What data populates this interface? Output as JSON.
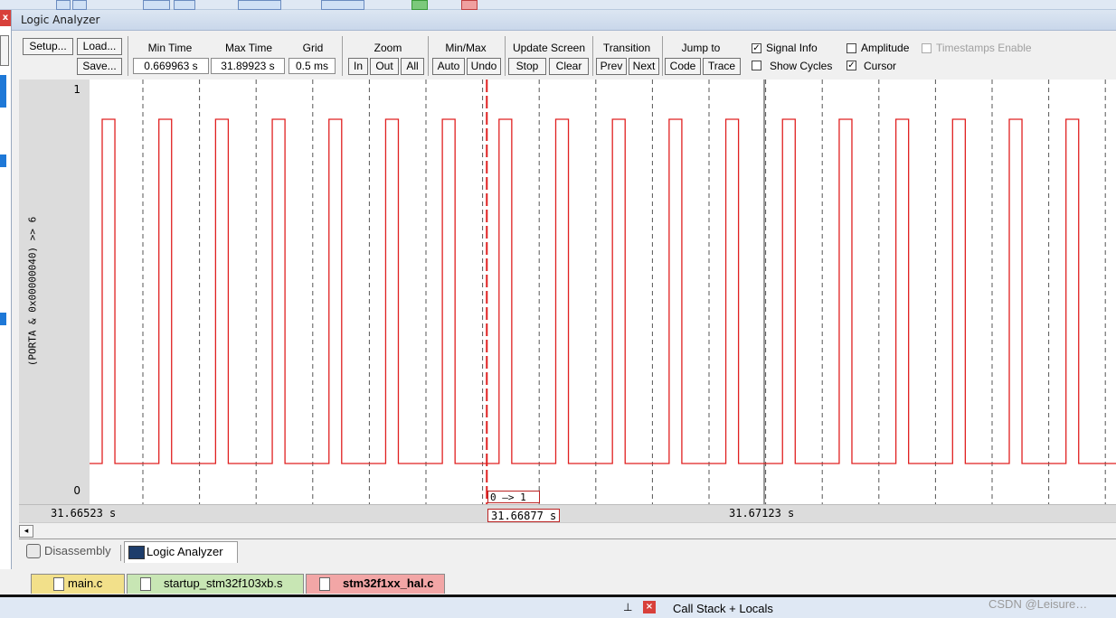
{
  "panel": {
    "title": "Logic Analyzer",
    "close_glyph": "x"
  },
  "controls": {
    "setup_label": "Setup...",
    "load_label": "Load...",
    "save_label": "Save...",
    "min_time_label": "Min Time",
    "min_time_value": "0.669963 s",
    "max_time_label": "Max Time",
    "max_time_value": "31.89923 s",
    "grid_label": "Grid",
    "grid_value": "0.5 ms",
    "zoom_label": "Zoom",
    "zoom_in": "In",
    "zoom_out": "Out",
    "zoom_all": "All",
    "minmax_label": "Min/Max",
    "minmax_auto": "Auto",
    "minmax_undo": "Undo",
    "update_label": "Update Screen",
    "update_stop": "Stop",
    "update_clear": "Clear",
    "transition_label": "Transition",
    "transition_prev": "Prev",
    "transition_next": "Next",
    "jump_label": "Jump to",
    "jump_code": "Code",
    "jump_trace": "Trace",
    "signal_info": {
      "label": "Signal Info",
      "checked": true
    },
    "amplitude": {
      "label": "Amplitude",
      "checked": false
    },
    "timestamps": {
      "label": "Timestamps Enable",
      "checked": false,
      "disabled": true
    },
    "show_cycles": {
      "label": "Show Cycles",
      "checked": false
    },
    "cursor": {
      "label": "Cursor",
      "checked": true
    }
  },
  "plot": {
    "signal_name": "(PORTA & 0x00000040) >> 6",
    "y_max_label": "1",
    "y_min_label": "0",
    "time_left": "31.66523 s",
    "time_center": "31.67123 s",
    "cursor_time": "31.66877 s",
    "transition_label": "0 —> 1",
    "signal_color": "#e02020",
    "cursor_color": "#e02020",
    "pulse_rising_times_ms": [
      0.0,
      0.625,
      1.25,
      1.875,
      2.5,
      3.125,
      3.75,
      4.375,
      5.0,
      5.625,
      6.25,
      6.875,
      7.5,
      8.125,
      8.75,
      9.375,
      10.0,
      10.625
    ],
    "pulse_width_ms": 0.14,
    "cursor_time_offset_ms": 4.24
  },
  "bottom_tabs": [
    {
      "label": "Disassembly",
      "active": false
    },
    {
      "label": "Logic Analyzer",
      "active": true
    }
  ],
  "file_tabs": [
    {
      "label": "main.c",
      "color": "#f2e08a"
    },
    {
      "label": "startup_stm32f103xb.s",
      "color": "#c8e6b4"
    },
    {
      "label": "stm32f1xx_hal.c",
      "color": "#f2a6a6"
    }
  ],
  "status": {
    "call_stack_label": "Call Stack + Locals",
    "watermark": "CSDN @Leisure…"
  }
}
